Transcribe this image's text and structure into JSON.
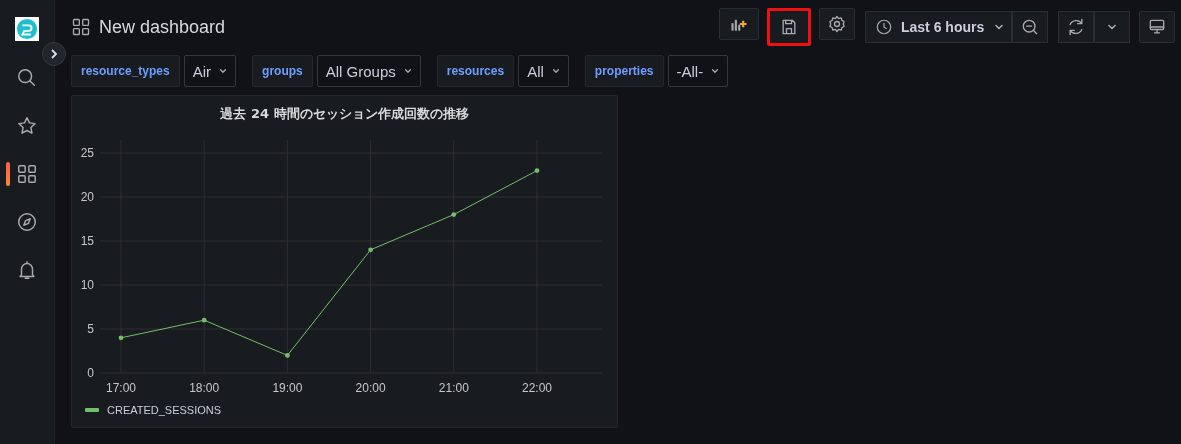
{
  "sidebar": {
    "items": [
      {
        "kind": "search",
        "selected": false
      },
      {
        "kind": "starred",
        "selected": false
      },
      {
        "kind": "dashboards",
        "selected": true
      },
      {
        "kind": "explore",
        "selected": false
      },
      {
        "kind": "alerting",
        "selected": false
      }
    ]
  },
  "header": {
    "title": "New dashboard",
    "toolbar": [
      {
        "kind": "add-panel",
        "highlighted": false
      },
      {
        "kind": "save",
        "highlighted": true
      },
      {
        "kind": "settings",
        "highlighted": false
      }
    ],
    "time_picker": {
      "label": "Last 6 hours"
    }
  },
  "variables": [
    {
      "label": "resource_types",
      "value": "Air"
    },
    {
      "label": "groups",
      "value": "All Groups"
    },
    {
      "label": "resources",
      "value": "All"
    },
    {
      "label": "properties",
      "value": "-All-"
    }
  ],
  "panel": {
    "title": "過去 24 時間のセッション作成回数の推移",
    "chart_data": {
      "type": "line",
      "categories": [
        "17:00",
        "18:00",
        "19:00",
        "20:00",
        "21:00",
        "22:00"
      ],
      "series": [
        {
          "name": "CREATED_SESSIONS",
          "color": "#73bf69",
          "values": [
            4,
            6,
            2,
            14,
            18,
            23
          ]
        }
      ],
      "grid": true,
      "ylim": [
        0,
        25
      ],
      "yticks": [
        0,
        5,
        10,
        15,
        20,
        25
      ]
    }
  }
}
